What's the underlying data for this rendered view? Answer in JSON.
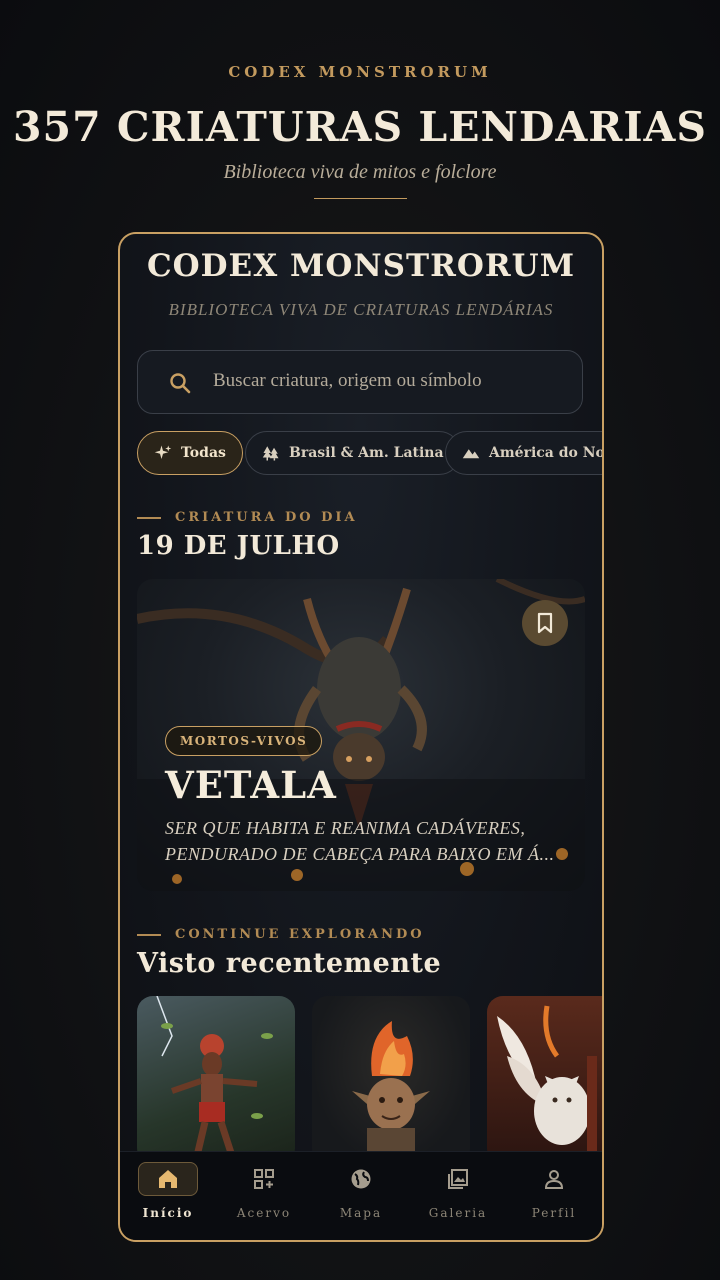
{
  "promo": {
    "eyebrow": "CODEX MONSTRORUM",
    "headline": "357 CRIATURAS LENDARIAS",
    "tagline": "Biblioteca viva de mitos e folclore"
  },
  "app": {
    "title": "CODEX MONSTRORUM",
    "subtitle": "Biblioteca viva de criaturas lendárias",
    "search": {
      "placeholder": "Buscar criatura, origem ou símbolo"
    },
    "chips": [
      {
        "label": "Todas",
        "icon": "sparkle-icon",
        "active": true
      },
      {
        "label": "Brasil & Am. Latina",
        "icon": "trees-icon",
        "active": false
      },
      {
        "label": "América do Norte",
        "icon": "mountain-icon",
        "active": false
      }
    ],
    "featured": {
      "section_label": "CRIATURA DO DIA",
      "date": "19 DE JULHO",
      "tag": "MORTOS-VIVOS",
      "name": "VETALA",
      "description": "Ser que habita e reanima cadáveres, pendurado de cabeça para baixo em á...",
      "bookmark_icon": "bookmark-icon"
    },
    "recent": {
      "section_label": "CONTINUE EXPLORANDO",
      "title": "Visto recentemente"
    },
    "nav": [
      {
        "label": "Início",
        "icon": "home-icon",
        "active": true
      },
      {
        "label": "Acervo",
        "icon": "grid-add-icon",
        "active": false
      },
      {
        "label": "Mapa",
        "icon": "globe-icon",
        "active": false
      },
      {
        "label": "Galeria",
        "icon": "gallery-icon",
        "active": false
      },
      {
        "label": "Perfil",
        "icon": "person-icon",
        "active": false
      }
    ]
  },
  "colors": {
    "accent": "#c9a063",
    "background": "#111214",
    "card": "#161a21"
  }
}
